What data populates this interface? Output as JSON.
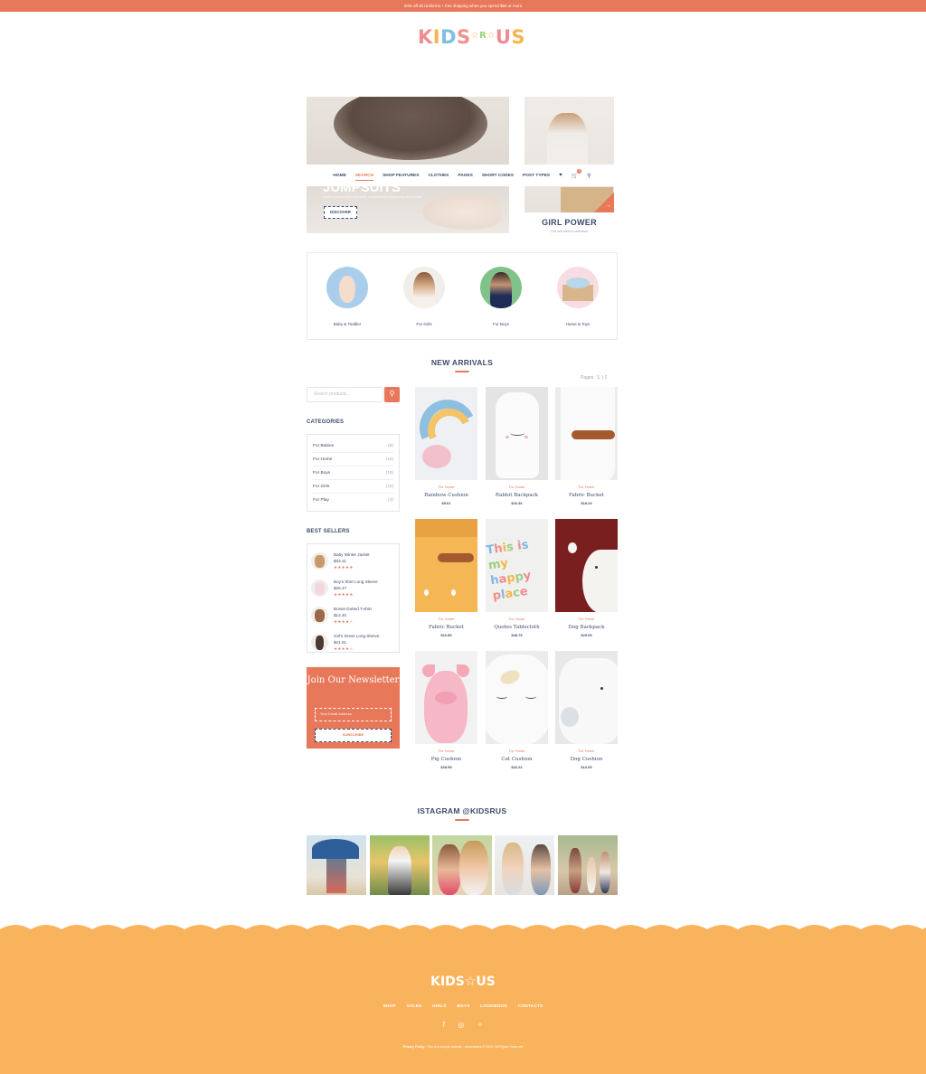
{
  "topbar": {
    "text": "20% off all Uniforms + free shipping when you spend $50 or more"
  },
  "logo": {
    "letters": [
      "K",
      "I",
      "D",
      "S",
      "☆",
      "R",
      "☆",
      "U",
      "S"
    ]
  },
  "hero": {
    "title": "JUMPSUITS",
    "subtitle": "Lorem ipsum dolor sit amet, consectetur adipiscing elit sed do",
    "button": "DISCOVER",
    "side_title": "GIRL POWER",
    "side_subtitle": "Our wonderful selection"
  },
  "nav": {
    "items": [
      "HOME",
      "SEARCH",
      "SHOP FEATURES",
      "CLOTHES",
      "PAGES",
      "SHORT CODES",
      "POST TYPES"
    ],
    "active": "SEARCH",
    "cart_count": "1"
  },
  "categories": [
    {
      "label": "Baby & Toddler"
    },
    {
      "label": "For Girls"
    },
    {
      "label": "For Boys"
    },
    {
      "label": "Home & Toys"
    }
  ],
  "new_arrivals": {
    "title": "NEW ARRIVALS",
    "pages_label": "Pages:",
    "page_current": "1",
    "page_next": "2"
  },
  "search": {
    "placeholder": "Search products..."
  },
  "sidebar": {
    "categories_title": "CATEGORIES",
    "category_list": [
      {
        "name": "For Babies",
        "count": "(5)"
      },
      {
        "name": "For Home",
        "count": "(10)"
      },
      {
        "name": "For Boys",
        "count": "(10)"
      },
      {
        "name": "For Girls",
        "count": "(10)"
      },
      {
        "name": "For Play",
        "count": "(3)"
      }
    ],
    "best_title": "BEST SELLERS",
    "best_sellers": [
      {
        "name": "Baby Winter Jacket",
        "price": "$33.11",
        "rating": 5
      },
      {
        "name": "Boy's Shirt Long Sleeve",
        "price": "$26.47",
        "rating": 5
      },
      {
        "name": "Brown Dotted T-shirt",
        "price": "$12.40",
        "rating": 4
      },
      {
        "name": "Girl's Dress Long Sleeve",
        "price": "$41.61",
        "rating": 4
      }
    ],
    "newsletter_title": "Join Our Newsletter",
    "newsletter_placeholder": "Your Email Address",
    "newsletter_button": "SUBSCRIBE"
  },
  "products": [
    {
      "category": "For Home",
      "name": "Rainbow Cushion",
      "price": "$9.61"
    },
    {
      "category": "For Home",
      "name": "Rabbit Backpack",
      "price": "$42.36"
    },
    {
      "category": "For Home",
      "name": "Fabric Bucket",
      "price": "$18.24"
    },
    {
      "category": "For Home",
      "name": "Fabric Bucket",
      "price": "$16.80"
    },
    {
      "category": "For Home",
      "name": "Quotes Tablecloth",
      "price": "$48.75"
    },
    {
      "category": "For Home",
      "name": "Dog Backpack",
      "price": "$29.05"
    },
    {
      "category": "For Home",
      "name": "Pig Cushion",
      "price": "$28.95"
    },
    {
      "category": "For Home",
      "name": "Cat Cushion",
      "price": "$42.22"
    },
    {
      "category": "For Home",
      "name": "Dog Cushion",
      "price": "$12.05"
    }
  ],
  "instagram": {
    "title": "ISTAGRAM @KIDSRUS"
  },
  "footer": {
    "logo": "KIDS☆US",
    "nav": [
      "SHOP",
      "SALES",
      "GIRLS",
      "BOYS",
      "LOOKBOOK",
      "CONTACTS"
    ],
    "social": [
      "f",
      "◎",
      "✧"
    ],
    "privacy": "Privacy Policy",
    "copyright": "/ This is a sample website - cmsmasters © 2023 / All Rights Reserved"
  }
}
